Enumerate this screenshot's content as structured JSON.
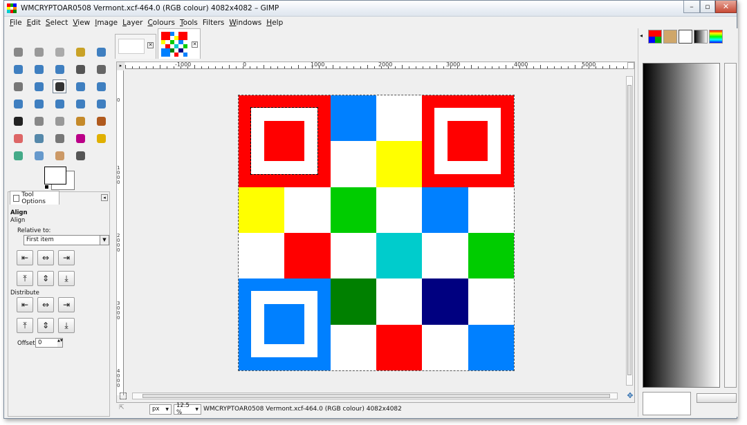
{
  "window": {
    "title": "WMCRYPTOAR0508 Vermont.xcf-464.0 (RGB colour) 4082x4082 – GIMP",
    "min_glyph": "–",
    "max_glyph": "▫",
    "close_glyph": "✕"
  },
  "menu": [
    {
      "key": "F",
      "rest": "ile"
    },
    {
      "key": "E",
      "rest": "dit"
    },
    {
      "key": "S",
      "rest": "elect"
    },
    {
      "key": "V",
      "rest": "iew"
    },
    {
      "key": "I",
      "rest": "mage"
    },
    {
      "key": "L",
      "rest": "ayer"
    },
    {
      "key": "C",
      "rest": "olours"
    },
    {
      "key": "T",
      "rest": "ools"
    },
    {
      "key": "",
      "rest": "Filters"
    },
    {
      "key": "W",
      "rest": "indows"
    },
    {
      "key": "H",
      "rest": "elp"
    }
  ],
  "tool_options": {
    "tab_label": "Tool Options",
    "heading": "Align",
    "subheading": "Align",
    "relative_label": "Relative to:",
    "relative_value": "First item",
    "distribute_label": "Distribute",
    "offset_label": "Offset:",
    "offset_value": "0"
  },
  "ruler_h": [
    {
      "label": "-1000",
      "pos": 72
    },
    {
      "label": "0",
      "pos": 170
    },
    {
      "label": "1000",
      "pos": 268
    },
    {
      "label": "2000",
      "pos": 366
    },
    {
      "label": "3000",
      "pos": 464
    },
    {
      "label": "4000",
      "pos": 562
    },
    {
      "label": "5000",
      "pos": 660
    }
  ],
  "ruler_v": [
    {
      "label": "0",
      "pos": 40
    },
    {
      "label": "1000",
      "pos": 138
    },
    {
      "label": "2000",
      "pos": 236
    },
    {
      "label": "3000",
      "pos": 334
    },
    {
      "label": "4000",
      "pos": 432
    }
  ],
  "status": {
    "unit": "px",
    "zoom": "12.5 %",
    "text": "WMCRYPTOAR0508 Vermont.xcf-464.0 (RGB colour) 4082x4082"
  },
  "image_grid": [
    [
      "#ff0000",
      "#ff0000",
      "#0080ff",
      "#ffffff",
      "#ff0000",
      "#ff0000"
    ],
    [
      "#ff0000",
      "#ff0000",
      "#ffffff",
      "#ffff00",
      "#ff0000",
      "#ff0000"
    ],
    [
      "#ffff00",
      "#ffffff",
      "#00cc00",
      "#ffffff",
      "#0080ff",
      "#ffffff"
    ],
    [
      "#ffffff",
      "#ff0000",
      "#ffffff",
      "#00cccc",
      "#ffffff",
      "#00cc00"
    ],
    [
      "#0080ff",
      "#0080ff",
      "#008000",
      "#ffffff",
      "#000080",
      "#ffffff"
    ],
    [
      "#0080ff",
      "#0080ff",
      "#ffffff",
      "#ff0000",
      "#ffffff",
      "#0080ff"
    ]
  ],
  "finders": [
    {
      "row": 0,
      "col": 0,
      "color": "#ff0000"
    },
    {
      "row": 0,
      "col": 4,
      "color": "#ff0000"
    },
    {
      "row": 4,
      "col": 0,
      "color": "#0080ff"
    }
  ],
  "colors": {
    "accent": "#3a6ea5",
    "icon": "#3f7fc0"
  }
}
